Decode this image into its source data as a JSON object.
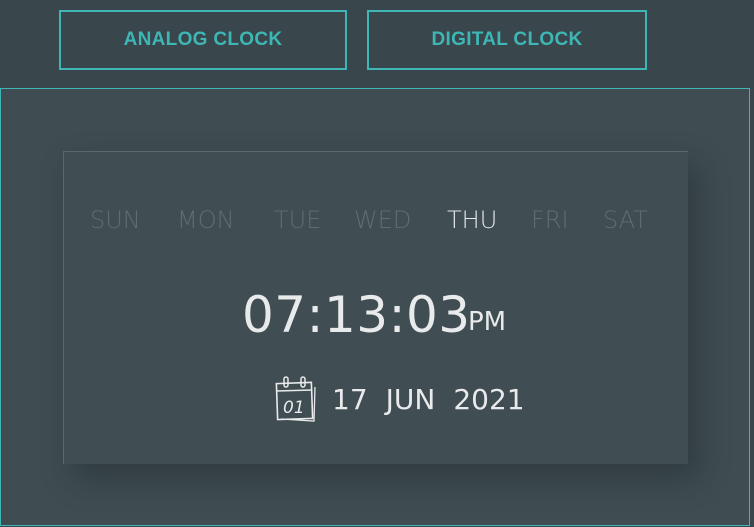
{
  "tabs": {
    "analog_label": "ANALOG CLOCK",
    "digital_label": "DIGITAL CLOCK"
  },
  "clock": {
    "days": [
      "SUN",
      "MON",
      "TUE",
      "WED",
      "THU",
      "FRI",
      "SAT"
    ],
    "active_day": "THU",
    "time": "07:13:03",
    "ampm": "PM",
    "calendar_icon_text": "01",
    "date": {
      "day": "17",
      "month": "JUN",
      "year": "2021"
    }
  },
  "colors": {
    "accent": "#3fb6b6",
    "background": "#39464b",
    "panel": "#404d52",
    "text": "#e8eaeb",
    "inactive_day": "#5f6c71"
  },
  "icons": {
    "calendar": "calendar-icon"
  }
}
